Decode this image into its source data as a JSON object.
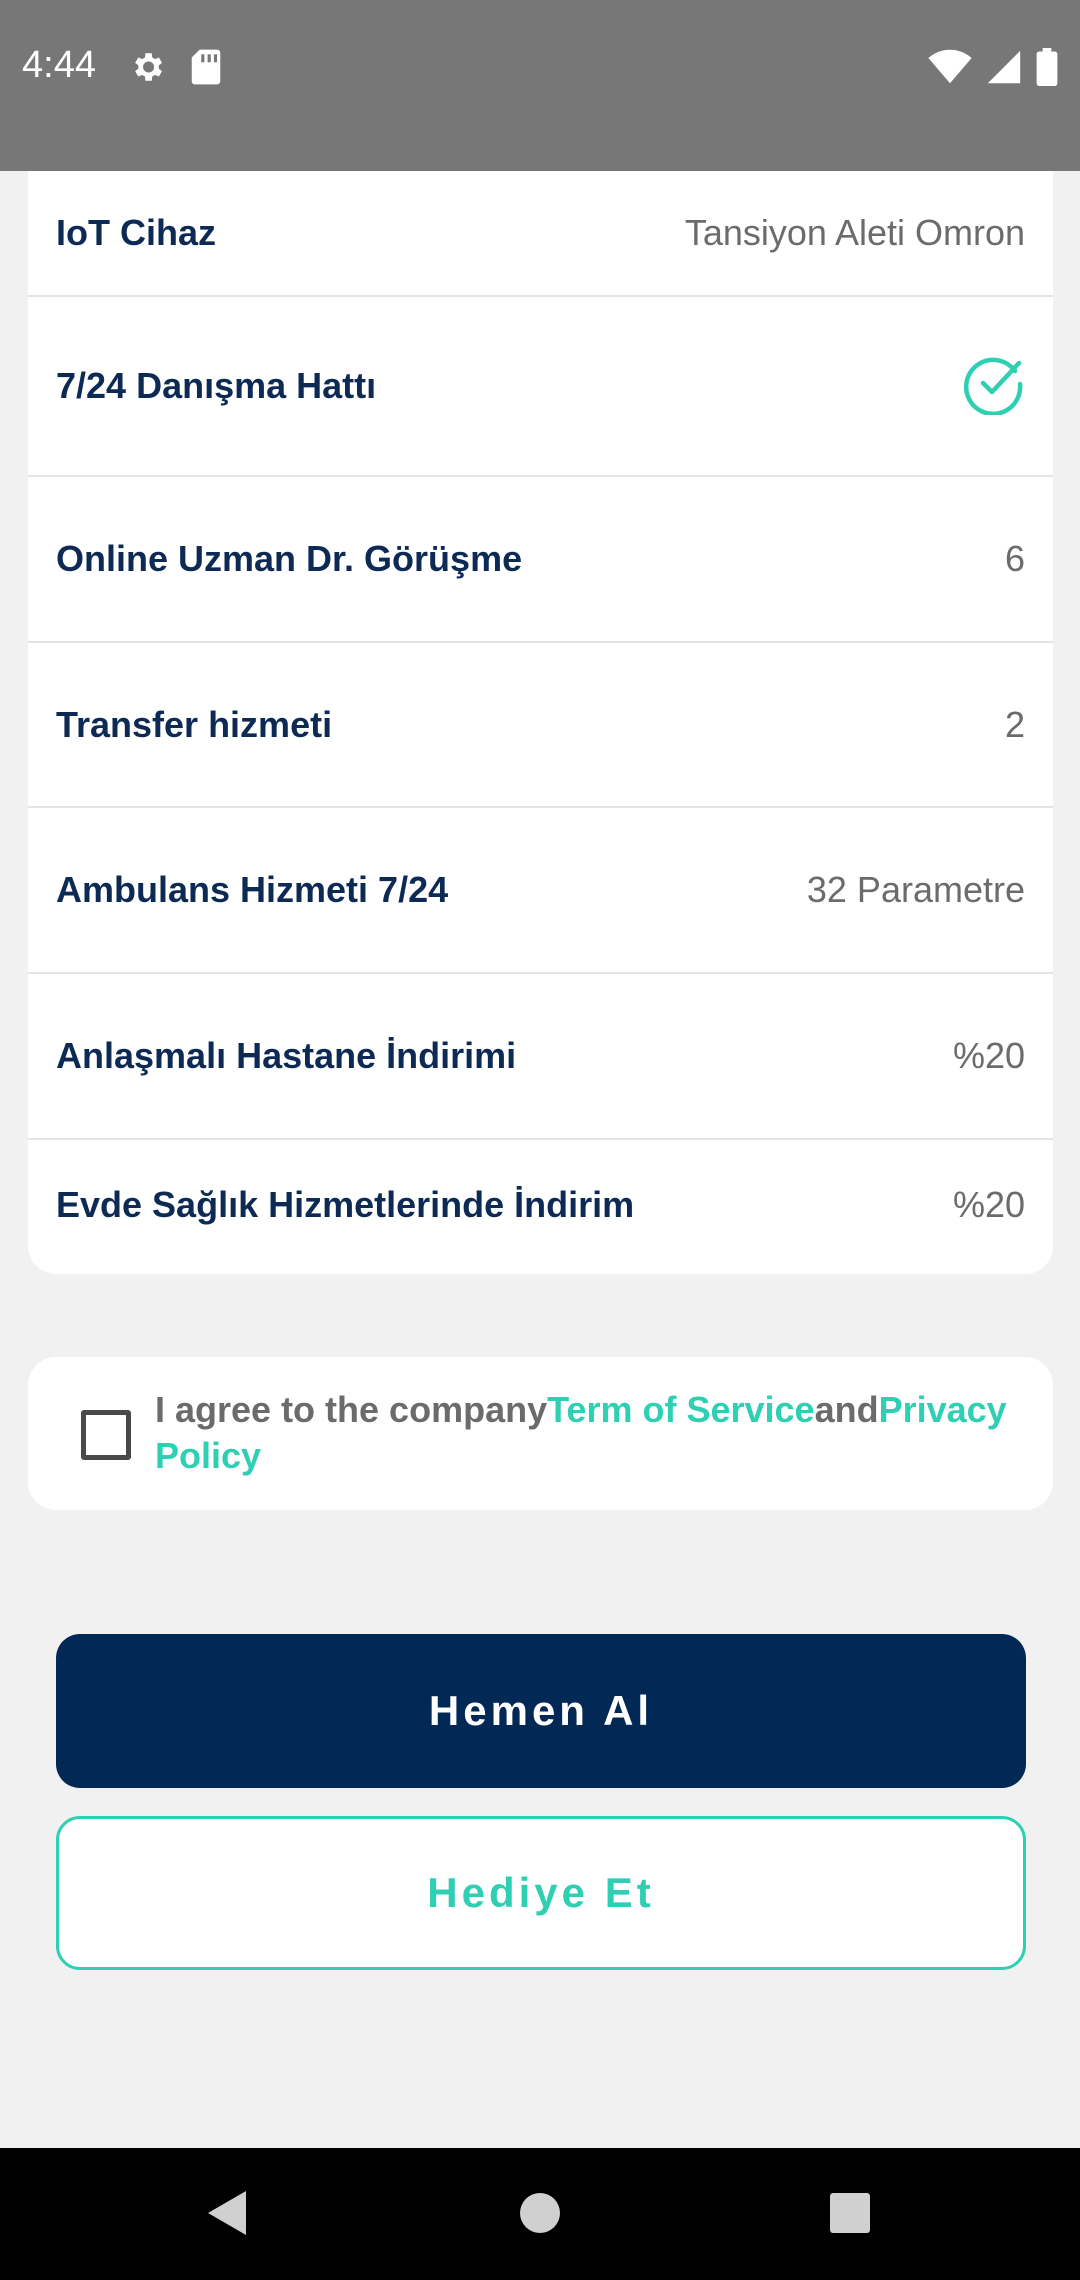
{
  "status_bar": {
    "time": "4:44",
    "icons_left": [
      "gear-icon",
      "sd-card-icon"
    ],
    "icons_right": [
      "wifi-icon",
      "cellular-signal-icon",
      "battery-icon"
    ]
  },
  "features": [
    {
      "name": "IoT Cihaz",
      "value": "Tansiyon Aleti Omron"
    },
    {
      "name": "7/24 Danışma Hattı",
      "value": "",
      "icon": "check-circle-icon"
    },
    {
      "name": "Online Uzman Dr. Görüşme",
      "value": "6"
    },
    {
      "name": "Transfer hizmeti",
      "value": "2"
    },
    {
      "name": "Ambulans Hizmeti 7/24",
      "value": "32 Parametre"
    },
    {
      "name": "Anlaşmalı Hastane İndirimi",
      "value": "%20"
    },
    {
      "name": "Evde Sağlık Hizmetlerinde İndirim",
      "value": "%20"
    }
  ],
  "agreement": {
    "checked": false,
    "prefix": "I agree to the company",
    "terms_link": "Term of Service",
    "conjunction": "and",
    "privacy_link": "Privacy Policy"
  },
  "actions": {
    "buy_label": "Hemen Al",
    "gift_label": "Hediye Et"
  },
  "colors": {
    "primary": "#022856",
    "accent": "#2fcfb3",
    "label": "#0d2a55"
  },
  "nav": {
    "buttons": [
      "back-icon",
      "home-icon",
      "recents-icon"
    ]
  }
}
